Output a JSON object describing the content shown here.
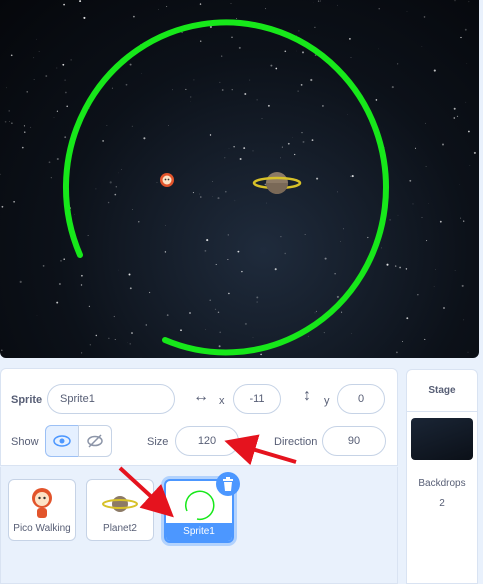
{
  "sprite_info": {
    "sprite_label": "Sprite",
    "sprite_name": "Sprite1",
    "x_label": "x",
    "x_value": "-11",
    "y_label": "y",
    "y_value": "0",
    "show_label": "Show",
    "size_label": "Size",
    "size_value": "120",
    "direction_label": "Direction",
    "direction_value": "90"
  },
  "sprites": [
    {
      "name": "Pico Walking"
    },
    {
      "name": "Planet2"
    },
    {
      "name": "Sprite1",
      "selected": true
    }
  ],
  "stage_panel": {
    "title": "Stage",
    "backdrops_label": "Backdrops",
    "backdrops_count": "2"
  },
  "colors": {
    "accent": "#4c97ff",
    "ring": "#17e81a",
    "arrow": "#e5131e"
  }
}
